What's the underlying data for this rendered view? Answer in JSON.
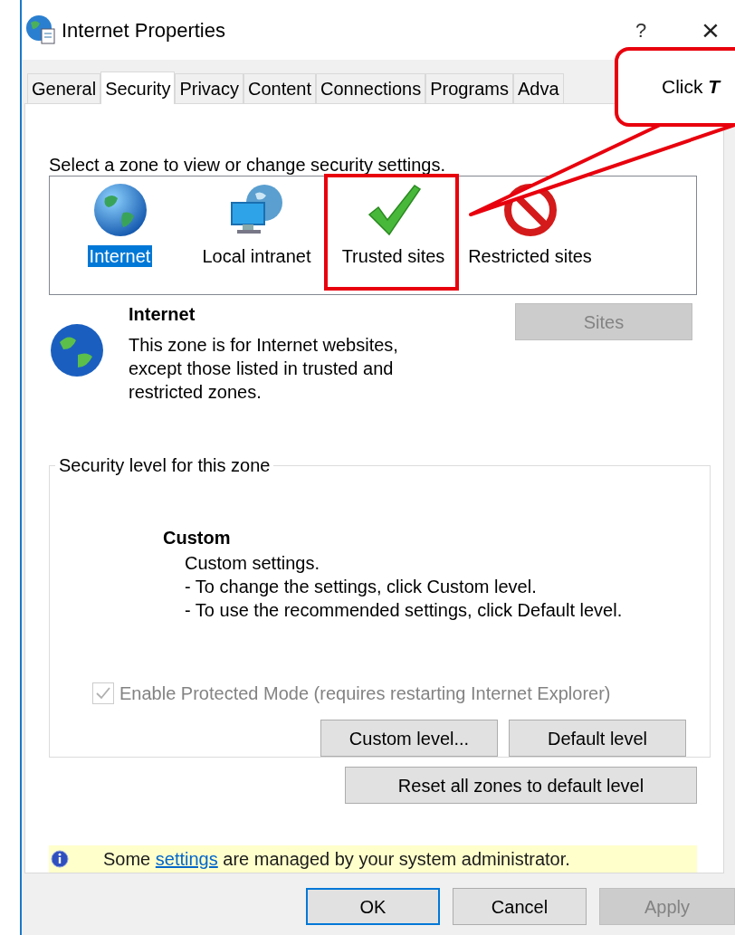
{
  "window": {
    "title": "Internet Properties",
    "help": "?",
    "close": "×"
  },
  "tabs": [
    {
      "label": "General",
      "selected": false
    },
    {
      "label": "Security",
      "selected": true
    },
    {
      "label": "Privacy",
      "selected": false
    },
    {
      "label": "Content",
      "selected": false
    },
    {
      "label": "Connections",
      "selected": false
    },
    {
      "label": "Programs",
      "selected": false
    },
    {
      "label": "Adva",
      "selected": false
    }
  ],
  "zone_prompt": "Select a zone to view or change security settings.",
  "zones": [
    {
      "label": "Internet",
      "kind": "globe",
      "selected": true
    },
    {
      "label": "Local intranet",
      "kind": "intranet",
      "selected": false
    },
    {
      "label": "Trusted sites",
      "kind": "check",
      "selected": false
    },
    {
      "label": "Restricted sites",
      "kind": "restricted",
      "selected": false
    }
  ],
  "zone_info": {
    "title": "Internet",
    "description": "This zone is for Internet websites, except those listed in trusted and restricted zones.",
    "sites_button": {
      "label": "Sites",
      "disabled": true
    }
  },
  "security_level": {
    "legend": "Security level for this zone",
    "level_name": "Custom",
    "lines": [
      "Custom settings.",
      "- To change the settings, click Custom level.",
      "- To use the recommended settings, click Default level."
    ],
    "protected_mode": {
      "label": "Enable Protected Mode (requires restarting Internet Explorer)",
      "checked": true,
      "disabled": true
    },
    "buttons": [
      "Custom level...",
      "Default level"
    ]
  },
  "reset_button": "Reset all zones to default level",
  "notice": {
    "before": "Some ",
    "link": "settings",
    "after": " are managed by your system administrator."
  },
  "footer_buttons": [
    {
      "label": "OK",
      "default": true,
      "disabled": false
    },
    {
      "label": "Cancel",
      "default": false,
      "disabled": false
    },
    {
      "label": "Apply",
      "default": false,
      "disabled": true
    }
  ],
  "callout": {
    "text": "Click **T**"
  }
}
